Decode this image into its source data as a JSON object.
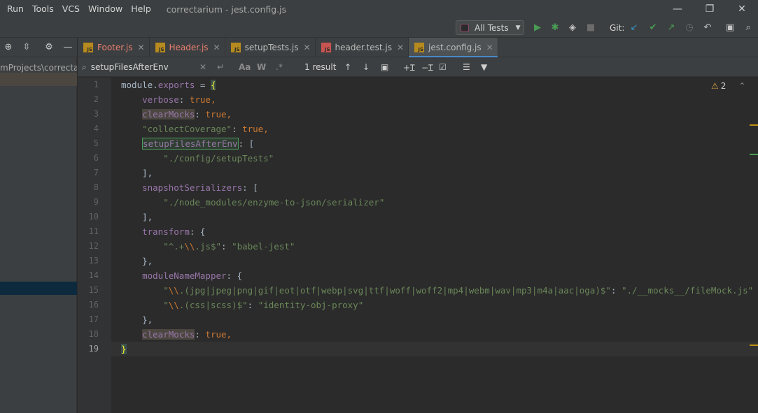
{
  "menu": [
    "Run",
    "Tools",
    "VCS",
    "Window",
    "Help"
  ],
  "window_title": "correctarium - jest.config.js",
  "window_controls": [
    "—",
    "❐",
    "✕"
  ],
  "toolbar": {
    "run_config": "All Tests",
    "git_label": "Git:"
  },
  "project": {
    "path": "mProjects\\correctarium"
  },
  "tabs": [
    {
      "label": "Footer.js",
      "color": "#e8806f",
      "active": false
    },
    {
      "label": "Header.js",
      "color": "#e8806f",
      "active": false
    },
    {
      "label": "setupTests.js",
      "color": "#d4d4d4",
      "active": false
    },
    {
      "label": "header.test.js",
      "color": "#d4d4d4",
      "active": false
    },
    {
      "label": "jest.config.js",
      "color": "#d4d4d4",
      "active": true
    }
  ],
  "find": {
    "query": "setupFilesAfterEnv",
    "result": "1 result"
  },
  "editor": {
    "line_numbers": [
      "1",
      "2",
      "3",
      "4",
      "5",
      "6",
      "7",
      "8",
      "9",
      "10",
      "11",
      "12",
      "13",
      "14",
      "15",
      "16",
      "17",
      "18",
      "19"
    ],
    "warnings": "2"
  },
  "code": {
    "l1_a": "module",
    "l1_b": ".",
    "l1_c": "exports",
    "l1_d": " = ",
    "l1_e": "{",
    "l2_key": "verbose",
    "l2_val": "true",
    "l3_key": "clearMocks",
    "l3_val": "true",
    "l4_key": "\"collectCoverage\"",
    "l4_val": "true",
    "l5_key": "setupFilesAfterEnv",
    "l5_rest": ": [",
    "l6_val": "\"./config/setupTests\"",
    "l7": "],",
    "l8_key": "snapshotSerializers",
    "l8_rest": ": [",
    "l9_val": "\"./node_modules/enzyme-to-json/serializer\"",
    "l10": "],",
    "l11_key": "transform",
    "l11_rest": ": {",
    "l12_k1": "\"^.+",
    "l12_k2": "\\\\",
    "l12_k3": ".js$\"",
    "l12_sep": ": ",
    "l12_val": "\"babel-jest\"",
    "l13": "},",
    "l14_key": "moduleNameMapper",
    "l14_rest": ": {",
    "l15_k1": "\"",
    "l15_k2": "\\\\",
    "l15_k3": ".(jpg|jpeg|png|gif|eot|otf|webp|svg|ttf|woff|woff2|mp4|webm|wav|mp3|m4a|aac|oga)$\"",
    "l15_sep": ": ",
    "l15_val": "\"./__mocks__/fileMock.js\"",
    "l16_k1": "\"",
    "l16_k2": "\\\\",
    "l16_k3": ".(css|scss)$\"",
    "l16_sep": ": ",
    "l16_val": "\"identity-obj-proxy\"",
    "l17": "},",
    "l18_key": "clearMocks",
    "l18_val": "true",
    "l19": "}"
  }
}
